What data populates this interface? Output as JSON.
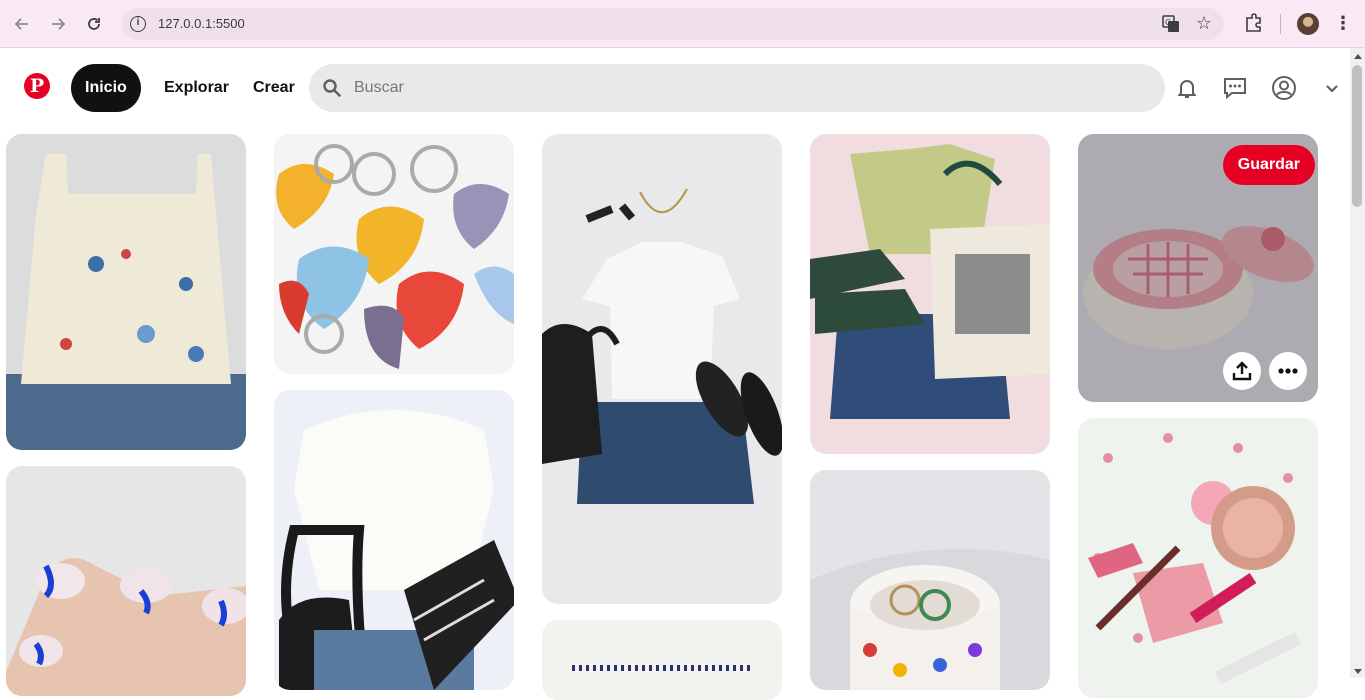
{
  "browser": {
    "url": "127.0.0.1:5500",
    "back_icon": "arrow-left-icon",
    "forward_icon": "arrow-right-icon",
    "reload_icon": "reload-icon"
  },
  "header": {
    "nav": {
      "home": "Inicio",
      "explore": "Explorar",
      "create": "Crear"
    },
    "search": {
      "placeholder": "Buscar"
    }
  },
  "pins": [
    {
      "id": "top-cami"
    },
    {
      "id": "keychains"
    },
    {
      "id": "outfit-tee-skirt"
    },
    {
      "id": "outfit-green-top"
    },
    {
      "id": "ceramic-box",
      "hovered": true,
      "save_label": "Guardar"
    },
    {
      "id": "blue-nails"
    },
    {
      "id": "white-blouse"
    },
    {
      "id": "embroidery"
    },
    {
      "id": "ring-dish"
    },
    {
      "id": "makeup-flatlay"
    }
  ],
  "colors": {
    "brand": "#e60023",
    "active_nav": "#111111"
  }
}
